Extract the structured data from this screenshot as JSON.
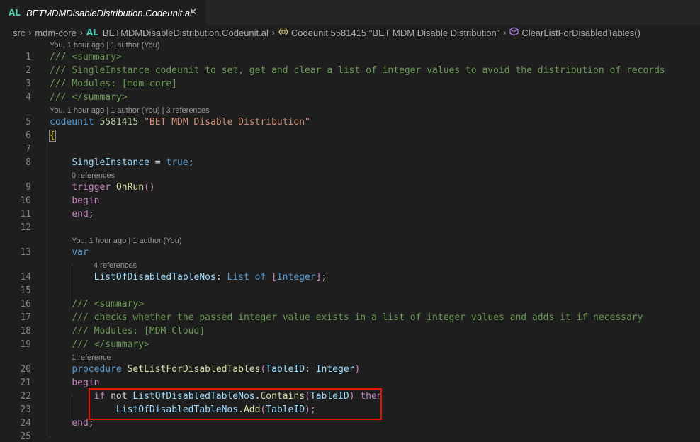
{
  "tab": {
    "lang": "AL",
    "title": "BETMDMDisableDistribution.Codeunit.al",
    "close": "✕"
  },
  "breadcrumb": {
    "items": [
      "src",
      "mdm-core",
      "BETMDMDisableDistribution.Codeunit.al",
      "Codeunit 5581415 \"BET MDM Disable Distribution\"",
      "ClearListForDisabledTables()"
    ],
    "al_label": "AL",
    "sep": "›"
  },
  "codelens": {
    "l1": "You, 1 hour ago | 1 author (You)",
    "l5": "You, 1 hour ago | 1 author (You) | 3 references",
    "l9": "0 references",
    "l13": "You, 1 hour ago | 1 author (You)",
    "l14": "4 references",
    "l20": "1 reference"
  },
  "lines": {
    "n1": "1",
    "n2": "2",
    "n3": "3",
    "n4": "4",
    "n5": "5",
    "n6": "6",
    "n7": "7",
    "n8": "8",
    "n9": "9",
    "n10": "10",
    "n11": "11",
    "n12": "12",
    "n13": "13",
    "n14": "14",
    "n15": "15",
    "n16": "16",
    "n17": "17",
    "n18": "18",
    "n19": "19",
    "n20": "20",
    "n21": "21",
    "n22": "22",
    "n23": "23",
    "n24": "24",
    "n25": "25"
  },
  "code": {
    "l1": "/// <summary>",
    "l2": "/// SingleInstance codeunit to set, get and clear a list of integer values to avoid the distribution of records",
    "l3": "/// Modules: [mdm-core]",
    "l4": "/// </summary>",
    "l5_kw": "codeunit",
    "l5_num": "5581415",
    "l5_str": "\"BET MDM Disable Distribution\"",
    "l6": "{",
    "l8_var": "SingleInstance",
    "l8_op": " = ",
    "l8_val": "true",
    "l8_end": ";",
    "l9_kw": "trigger",
    "l9_fn": "OnRun",
    "l9_paren": "()",
    "l10": "begin",
    "l11": "end",
    "l11_end": ";",
    "l13": "var",
    "l14_var": "ListOfDisabledTableNos",
    "l14_colon": ": ",
    "l14_kw1": "List",
    "l14_kw2": "of",
    "l14_br1": "[",
    "l14_type": "Integer",
    "l14_br2": "]",
    "l14_end": ";",
    "l16": "/// <summary>",
    "l17": "/// checks whether the passed integer value exists in a list of integer values and adds it if necessary",
    "l18": "/// Modules: [MDM-Cloud]",
    "l19": "/// </summary>",
    "l20_kw": "procedure",
    "l20_fn": "SetListForDisabledTables",
    "l20_p1": "(",
    "l20_var": "TableID",
    "l20_colon": ": ",
    "l20_type": "Integer",
    "l20_p2": ")",
    "l21": "begin",
    "l22_if": "if",
    "l22_not": "not",
    "l22_var": "ListOfDisabledTableNos",
    "l22_dot": ".",
    "l22_fn": "Contains",
    "l22_p1": "(",
    "l22_arg": "TableID",
    "l22_p2": ")",
    "l22_then": "then",
    "l23_var": "ListOfDisabledTableNos",
    "l23_dot": ".",
    "l23_fn": "Add",
    "l23_p1": "(",
    "l23_arg": "TableID",
    "l23_p2": ");",
    "l24": "end",
    "l24_end": ";"
  }
}
